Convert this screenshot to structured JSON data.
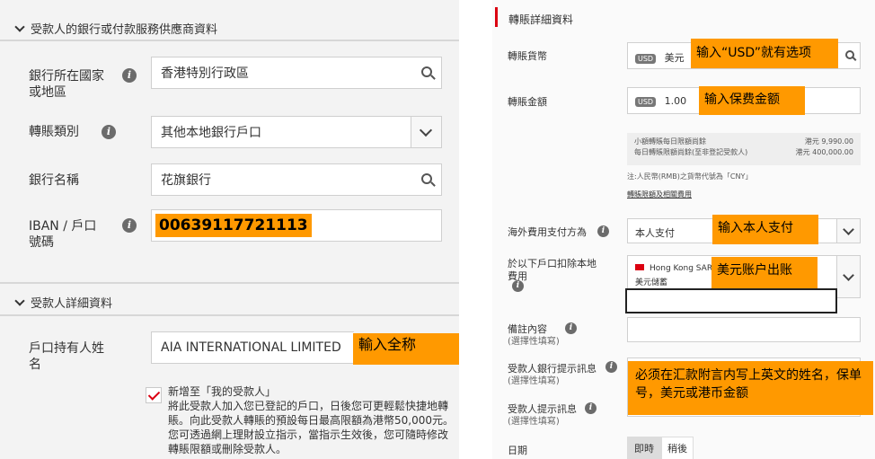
{
  "left": {
    "bank_section": {
      "title": "受款人的銀行或付款服務供應商資料",
      "country_label": "銀行所在國家或地區",
      "country_value": "香港特別行政區",
      "transfer_type_label": "轉賬類別",
      "transfer_type_value": "其他本地銀行戶口",
      "bank_name_label": "銀行名稱",
      "bank_name_value": "花旗銀行",
      "account_label": "IBAN / 戶口號碼",
      "account_value": "00639117721113"
    },
    "payee_section": {
      "title": "受款人詳細資料",
      "holder_label": "戶口持有人姓名",
      "holder_value": "AIA INTERNATIONAL LIMITED",
      "holder_note": "輸入全称",
      "add_payee_title": "新增至「我的受款人」",
      "add_payee_desc": "將此受款人加入您已登記的戶口，日後您可更輕鬆快捷地轉賬。向此受款人轉賬的預設每日最高限額為港幣50,000元。您可透過網上理財設立指示，當指示生效後，您可隨時修改轉賬限額或刪除受款人。"
    }
  },
  "right": {
    "title": "轉賬詳細資料",
    "currency_label": "轉賬貨幣",
    "currency_badge": "USD",
    "currency_value": "美元",
    "currency_note": "输入“USD”就有选项",
    "amount_label": "轉賬金額",
    "amount_badge": "USD",
    "amount_value": "1.00",
    "amount_note": "输入保费金额",
    "limits": [
      {
        "label": "小額轉賬每日限額尚餘",
        "value": "港元 9,990.00"
      },
      {
        "label": "每日轉賬限額尚餘(至非登記受款人)",
        "value": "港元 400,000.00"
      }
    ],
    "rmb_note": "注:人民幣(RMB)之貨幣代號為「CNY」",
    "fee_link": "轉賬限額及相關費用",
    "charges_label": "海外費用支付方為",
    "charges_value": "本人支付",
    "charges_note": "输入本人支付",
    "debit_label": "於以下戶口扣除本地費用",
    "debit_region": "Hong Kong SAR",
    "debit_account": "美元儲蓄",
    "debit_note": "美元账户出账",
    "remarks_label": "備註內容",
    "optional": "(選擇性填寫)",
    "bank_msg_label": "受款人銀行提示訊息",
    "payee_msg_label": "受款人提示訊息",
    "message_note": "必须在汇款附言内写上英文的姓名，保单号，美元或港币金额",
    "date_label": "日期",
    "date_now": "即時",
    "date_later": "稍後"
  }
}
